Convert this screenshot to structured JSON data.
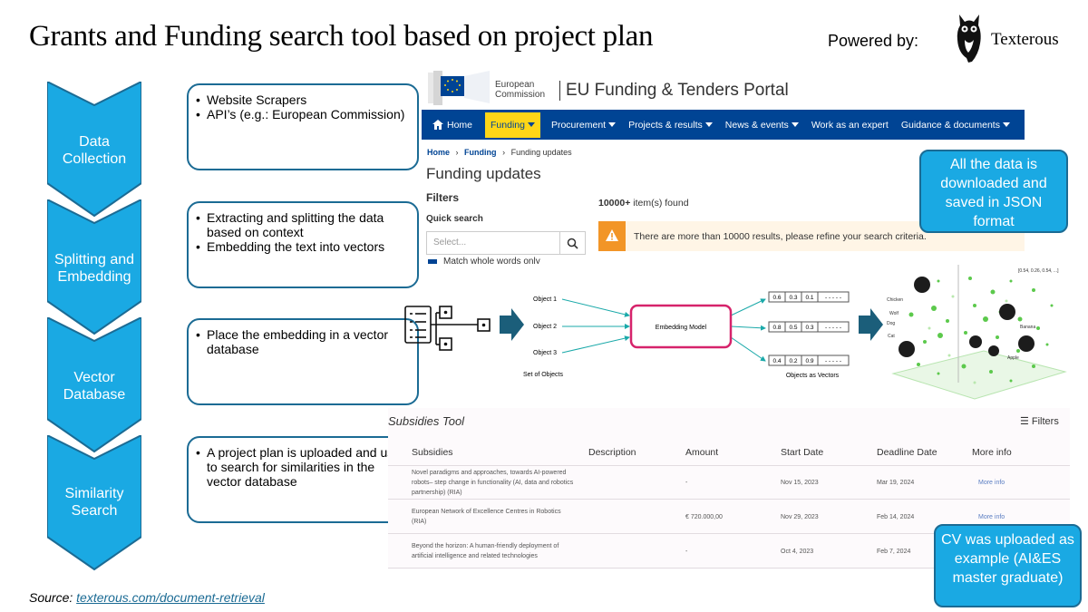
{
  "title": "Grants and Funding search tool based on project plan",
  "powered_by": "Powered by:",
  "brand": "Texterous",
  "stages": [
    {
      "label": "Data Collection",
      "bullets": [
        "Website Scrapers",
        "API’s (e.g.: European Commission)"
      ]
    },
    {
      "label": "Splitting and Embedding",
      "bullets": [
        "Extracting and splitting the data based on context",
        "Embedding the text into vectors"
      ]
    },
    {
      "label": "Vector Database",
      "bullets": [
        "Place the embedding in a vector database"
      ]
    },
    {
      "label": "Similarity Search",
      "bullets": [
        "A project plan is uploaded and used to search for similarities in the vector database"
      ]
    }
  ],
  "portal": {
    "ec_line1": "European",
    "ec_line2": "Commission",
    "title": "EU Funding & Tenders Portal",
    "nav": [
      "Home",
      "Funding",
      "Procurement",
      "Projects & results",
      "News & events",
      "Work as an expert",
      "Guidance & documents"
    ],
    "breadcrumb": [
      "Home",
      "Funding",
      "Funding updates"
    ],
    "page_title": "Funding updates",
    "filters": "Filters",
    "quick_search": "Quick search",
    "select_placeholder": "Select...",
    "checkbox_label": "Match whole words only",
    "found_count": "10000+",
    "found_suffix": " item(s) found",
    "warning": "There are more than 10000 results, please refine your search criteria."
  },
  "tip_json": "All the data is downloaded and saved in JSON format",
  "tip_cv": "CV was uploaded as example (AI&ES master graduate)",
  "embedding": {
    "objects": [
      "Object 1",
      "Object 2",
      "Object 3"
    ],
    "set_label": "Set of Objects",
    "model": "Embedding Model",
    "vectors": [
      [
        "0.6",
        "0.3",
        "0.1",
        "- - - - -"
      ],
      [
        "0.8",
        "0.5",
        "0.3",
        "- - - - -"
      ],
      [
        "0.4",
        "0.2",
        "0.9",
        "- - - - -"
      ]
    ],
    "vectors_label": "Objects as Vectors",
    "space_labels": [
      "Chicken",
      "Wolf",
      "Dog",
      "Cat",
      "Banana",
      "Apple"
    ],
    "space_vector": "[0.54, 0.26, 0.54, ...]"
  },
  "subsidies": {
    "title": "Subsidies Tool",
    "filters": "Filters",
    "headers": [
      "Subsidies",
      "Description",
      "Amount",
      "Start Date",
      "Deadline Date",
      "More info"
    ],
    "rows": [
      {
        "name": "Novel paradigms and approaches, towards AI-powered robots– step change in functionality (AI, data and robotics partnership) (RIA)",
        "amount": "-",
        "start": "Nov 15, 2023",
        "deadline": "Mar 19, 2024",
        "more": "More info"
      },
      {
        "name": "European Network of Excellence Centres in Robotics (RIA)",
        "amount": "€ 720.000,00",
        "start": "Nov 29, 2023",
        "deadline": "Feb 14, 2024",
        "more": "More info"
      },
      {
        "name": "Beyond the horizon: A human-friendly deployment of artificial intelligence and related technologies",
        "amount": "-",
        "start": "Oct 4, 2023",
        "deadline": "Feb 7, 2024",
        "more": ""
      }
    ]
  },
  "source_label": "Source:",
  "source_link": "texterous.com/document-retrieval",
  "colors": {
    "accent": "#1aa9e3",
    "border": "#1b6b94",
    "eu_blue": "#004494",
    "eu_yellow": "#ffd617",
    "model_border": "#d6236b",
    "arrow": "#1b5e7a"
  }
}
